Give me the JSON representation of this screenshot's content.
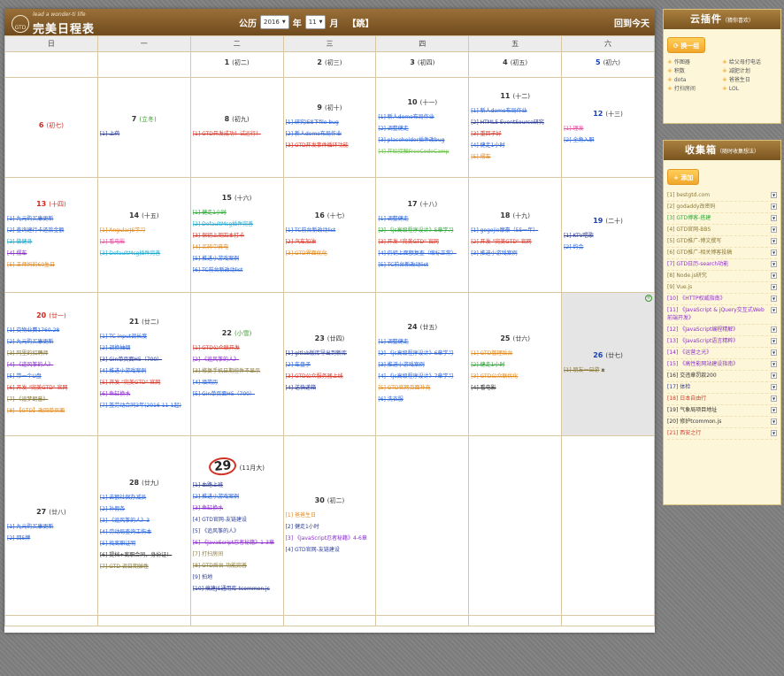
{
  "header": {
    "logo_slogan": "lead a wonder-ti life",
    "logo_badge": "GTD",
    "app_title": "完美日程表",
    "calendar_label": "公历",
    "year_value": "2016",
    "year_unit": "年",
    "month_value": "11",
    "month_unit": "月",
    "jump_label": "【跳】",
    "goto_today": "回到今天"
  },
  "weekdays": [
    "日",
    "一",
    "二",
    "三",
    "四",
    "五",
    "六"
  ],
  "weeks": [
    {
      "row": "r0",
      "cells": [
        {
          "empty": true
        },
        {
          "empty": true
        },
        {
          "day": "1",
          "lunar": "(初二)",
          "events": []
        },
        {
          "day": "2",
          "lunar": "(初三)",
          "events": []
        },
        {
          "day": "3",
          "lunar": "(初四)",
          "events": []
        },
        {
          "day": "4",
          "lunar": "(初五)",
          "events": []
        },
        {
          "day": "5",
          "lunar": "(初六)",
          "dow": "sat",
          "events": []
        }
      ]
    },
    {
      "row": "r1",
      "cells": [
        {
          "day": "6",
          "lunar": "(初七)",
          "dow": "sun",
          "events": []
        },
        {
          "day": "7",
          "lunar": "(立冬)",
          "term": true,
          "events": [
            {
              "text": "[1] 上药",
              "color": "c-navy",
              "done": true
            }
          ]
        },
        {
          "day": "8",
          "lunar": "(初九)",
          "events": [
            {
              "text": "[1] GTD开发成功！试运行！",
              "color": "c-red",
              "done": true
            }
          ]
        },
        {
          "day": "9",
          "lunar": "(初十)",
          "events": [
            {
              "text": "[1] 研究IE8下file bug",
              "color": "c-blue",
              "done": true
            },
            {
              "text": "[2] 新人demo布局作业",
              "color": "c-blue",
              "done": true
            },
            {
              "text": "[3] GTD开发事件循环功能",
              "color": "c-red",
              "done": true
            }
          ]
        },
        {
          "day": "10",
          "lunar": "(十一)",
          "events": [
            {
              "text": "[1] 新人demo布局作业",
              "color": "c-blue",
              "done": true
            },
            {
              "text": "[2] 调整健走",
              "color": "c-blue",
              "done": true
            },
            {
              "text": "[3] placeholder插件改bug",
              "color": "c-blue",
              "done": true
            },
            {
              "text": "[4] 开始接触FreeCodeCamp",
              "color": "c-lgreen",
              "done": true
            }
          ]
        },
        {
          "day": "11",
          "lunar": "(十二)",
          "events": [
            {
              "text": "[1] 新人demo布局作业",
              "color": "c-blue",
              "done": true
            },
            {
              "text": "[2] HTML5 EventSource研究",
              "color": "c-navy",
              "done": true
            },
            {
              "text": "[3] 重回子好",
              "color": "c-red",
              "done": true
            },
            {
              "text": "[4] 健走1小时",
              "color": "c-blue",
              "done": true
            },
            {
              "text": "[5] 摆车",
              "color": "c-orange",
              "done": true
            }
          ]
        },
        {
          "day": "12",
          "lunar": "(十三)",
          "dow": "sat",
          "events": [
            {
              "text": "[1] 理发",
              "color": "c-pink",
              "done": true
            },
            {
              "text": "[2] 全角入职",
              "color": "c-blue",
              "done": true
            }
          ]
        }
      ]
    },
    {
      "row": "r2",
      "cells": [
        {
          "day": "13",
          "lunar": "(十四)",
          "dow": "sun",
          "events": [
            {
              "text": "[1] 九元购买康更新",
              "color": "c-blue",
              "done": true
            },
            {
              "text": "[2] 查询建行卡还款金额",
              "color": "c-blue",
              "done": true
            },
            {
              "text": "[3] 做健身",
              "color": "c-cyan",
              "done": true
            },
            {
              "text": "[4] 摆车",
              "color": "c-purple",
              "done": true
            },
            {
              "text": "[5] 王师妈的60生日",
              "color": "c-orange",
              "done": true
            }
          ]
        },
        {
          "day": "14",
          "lunar": "(十五)",
          "events": [
            {
              "text": "[1] AngularJS学习",
              "color": "c-orange",
              "done": true
            },
            {
              "text": "[2] 看电影",
              "color": "c-pink",
              "done": true
            },
            {
              "text": "[3] DefaultMsg插件完善",
              "color": "c-cyan",
              "done": true
            }
          ]
        },
        {
          "day": "15",
          "lunar": "(十六)",
          "events": [
            {
              "text": "[1] 健走1小时",
              "color": "c-green",
              "done": true
            },
            {
              "text": "[2] DefaultMsg插件完善",
              "color": "c-cyan",
              "done": true
            },
            {
              "text": "[3] 保钥上周四本打卡",
              "color": "c-red",
              "done": true
            },
            {
              "text": "[4] 买碎中夹电",
              "color": "c-orange",
              "done": true
            },
            {
              "text": "[5] 推进小游戏案例",
              "color": "c-blue",
              "done": true
            },
            {
              "text": "[6] TC前台新改动list",
              "color": "c-blue",
              "done": true
            }
          ]
        },
        {
          "day": "16",
          "lunar": "(十七)",
          "events": [
            {
              "text": "[1] TC前台新改动list",
              "color": "c-blue",
              "done": true
            },
            {
              "text": "[2] 汽车加油",
              "color": "c-red",
              "done": true
            },
            {
              "text": "[3] GTD界面优化",
              "color": "c-orange",
              "done": true
            }
          ]
        },
        {
          "day": "17",
          "lunar": "(十八)",
          "events": [
            {
              "text": "[1] 调整健走",
              "color": "c-blue",
              "done": true
            },
            {
              "text": "[2] 《js高级程序设计》5章学习",
              "color": "c-green",
              "done": true
            },
            {
              "text": "[3] 开发 \"完美GTD\" 官网",
              "color": "c-red",
              "done": true
            },
            {
              "text": "[4] 仍钥上面额复查（缩标正常）",
              "color": "c-blue",
              "done": true
            },
            {
              "text": "[5] TC前台新改动list",
              "color": "c-blue",
              "done": true
            }
          ]
        },
        {
          "day": "18",
          "lunar": "(十九)",
          "events": [
            {
              "text": "[1] gogojie摩豪（55一年）",
              "color": "c-blue",
              "done": true
            },
            {
              "text": "[2] 开发 \"完美GTD\" 官网",
              "color": "c-red",
              "done": true
            },
            {
              "text": "[3] 推进小游戏案例",
              "color": "c-blue",
              "done": true
            }
          ]
        },
        {
          "day": "19",
          "lunar": "(二十)",
          "dow": "sat",
          "events": [
            {
              "text": "[1] KTV唱歌",
              "color": "c-navy",
              "done": true
            },
            {
              "text": "[2] 约会",
              "color": "c-blue",
              "done": true
            }
          ]
        }
      ]
    },
    {
      "row": "r3",
      "cells": [
        {
          "day": "20",
          "lunar": "(廿一)",
          "dow": "sun",
          "events": [
            {
              "text": "[1] 交物业费1760.28",
              "color": "c-blue",
              "done": true
            },
            {
              "text": "[2] 九元购买康更新",
              "color": "c-blue",
              "done": true
            },
            {
              "text": "[3] 阿里的招聘师",
              "color": "c-olive",
              "done": true
            },
            {
              "text": "[4] 《道风筝的人》",
              "color": "c-purple",
              "done": true
            },
            {
              "text": "[5] 带一个U盘",
              "color": "c-blue",
              "done": true
            },
            {
              "text": "[6] 开发 \"完美GTD\" 官网",
              "color": "c-red",
              "done": true
            },
            {
              "text": "[7] 《追梦朗普》",
              "color": "c-olive",
              "done": true
            },
            {
              "text": "[8] 【GTD】改回单页面",
              "color": "c-orange",
              "done": true
            }
          ]
        },
        {
          "day": "21",
          "lunar": "(廿二)",
          "events": [
            {
              "text": "[1] TC input调长度",
              "color": "c-blue",
              "done": true
            },
            {
              "text": "[2] 调换抽烟",
              "color": "c-blue",
              "done": true
            },
            {
              "text": "[3] Gin单页面H5（700）",
              "color": "c-navy",
              "done": true
            },
            {
              "text": "[4] 推进小游戏案例",
              "color": "c-blue",
              "done": true
            },
            {
              "text": "[5] 开发 \"完美GTD\" 官网",
              "color": "c-red",
              "done": true
            },
            {
              "text": "[6] 鱼缸换水",
              "color": "c-purple",
              "done": true
            },
            {
              "text": "[7] 签劳动合同3年(2016-11-1起)",
              "color": "c-blue",
              "done": true
            }
          ]
        },
        {
          "day": "22",
          "lunar": "(小雪)",
          "term": true,
          "events": [
            {
              "text": "[1] GTD公众联开发",
              "color": "c-red",
              "done": true
            },
            {
              "text": "[2] 《追风筝的人》",
              "color": "c-purple",
              "done": true
            },
            {
              "text": "[3] 修复手机日期控件不显示",
              "color": "c-olive",
              "done": true
            },
            {
              "text": "[4] 填简历",
              "color": "c-blue",
              "done": true
            },
            {
              "text": "[5] Gin单页面H5（700）",
              "color": "c-blue",
              "done": true
            }
          ]
        },
        {
          "day": "23",
          "lunar": "(廿四)",
          "events": [
            {
              "text": "[1] gitlab版库导出到新库",
              "color": "c-navy",
              "done": true
            },
            {
              "text": "[2] 车盘子",
              "color": "c-blue",
              "done": true
            },
            {
              "text": "[3] GTD公众服务器上线",
              "color": "c-red",
              "done": true
            },
            {
              "text": "[4] 送快递箱",
              "color": "c-navy",
              "done": true
            }
          ]
        },
        {
          "day": "24",
          "lunar": "(廿五)",
          "events": [
            {
              "text": "[1] 调整健走",
              "color": "c-blue",
              "done": true
            },
            {
              "text": "[2] 《js高级程序设计》6章学习",
              "color": "c-blue",
              "done": true
            },
            {
              "text": "[3] 推进小游戏案例",
              "color": "c-blue",
              "done": true
            },
            {
              "text": "[4] 《js高级程序设计》7章学习",
              "color": "c-blue",
              "done": true
            },
            {
              "text": "[5] GTD官网页面补充",
              "color": "c-orange",
              "done": true
            },
            {
              "text": "[6] 洗衣服",
              "color": "c-blue",
              "done": true
            }
          ]
        },
        {
          "day": "25",
          "lunar": "(廿六)",
          "events": [
            {
              "text": "[1] GTD管理后台",
              "color": "c-orange",
              "done": true
            },
            {
              "text": "[2] 健走1小时",
              "color": "c-green",
              "done": true
            },
            {
              "text": "[3] GTD公众联优化",
              "color": "c-orange",
              "done": true
            },
            {
              "text": "[4] 看电影",
              "color": "c-dark",
              "done": true
            }
          ]
        },
        {
          "day": "26",
          "lunar": "(廿七)",
          "dow": "sat",
          "gray": true,
          "plus": true,
          "events": [
            {
              "text": "[1] 朋友一日游",
              "color": "c-olive",
              "done": true,
              "dropdown": true
            }
          ]
        }
      ]
    },
    {
      "row": "r4",
      "cells": [
        {
          "day": "27",
          "lunar": "(廿八)",
          "events": [
            {
              "text": "[1] 九元购买康更新",
              "color": "c-blue",
              "done": true
            },
            {
              "text": "[2] 回5牌",
              "color": "c-blue",
              "done": true
            }
          ]
        },
        {
          "day": "28",
          "lunar": "(廿九)",
          "events": [
            {
              "text": "[1] 去额社保办减员",
              "color": "c-blue",
              "done": true
            },
            {
              "text": "[2] 补假条",
              "color": "c-blue",
              "done": true
            },
            {
              "text": "[3] 《追风筝的人》3",
              "color": "c-blue",
              "done": true
            },
            {
              "text": "[4] 劳动局查询工伤本",
              "color": "c-blue",
              "done": true
            },
            {
              "text": "[5] 找离职证明",
              "color": "c-blue",
              "done": true
            },
            {
              "text": "[6] 提档+离职合同，身份证！",
              "color": "c-dark",
              "done": true
            },
            {
              "text": "[7] GTD 调日期弹性",
              "color": "c-olive",
              "done": true
            }
          ]
        },
        {
          "day": "29",
          "lunar": "(11月大)",
          "today": true,
          "events": [
            {
              "text": "[1] 血路上班",
              "color": "c-navy",
              "done": true
            },
            {
              "text": "[2] 推进小游戏案例",
              "color": "c-blue",
              "done": true
            },
            {
              "text": "[3] 鱼缸换水",
              "color": "c-purple",
              "done": true
            },
            {
              "text": "[4] GTD官网-友链建设",
              "color": "c-navy",
              "done": false
            },
            {
              "text": "[5] 《追风筝的人》",
              "color": "c-navy",
              "done": false
            },
            {
              "text": "[6] 《JavaScript忍者秘籍》1-3章",
              "color": "c-purple",
              "done": true
            },
            {
              "text": "[7] 打扫房间",
              "color": "c-olive",
              "done": false
            },
            {
              "text": "[8] GTD后台-功能完善",
              "color": "c-olive",
              "done": true
            },
            {
              "text": "[9] 拍地",
              "color": "c-navy",
              "done": false
            },
            {
              "text": "[10] 搞建JS通用库-tcommon.js",
              "color": "c-navy",
              "done": true
            }
          ]
        },
        {
          "day": "30",
          "lunar": "(初二)",
          "events": [
            {
              "text": "[1] 爸爸生日",
              "color": "c-orange",
              "done": false
            },
            {
              "text": "[2] 健走1小时",
              "color": "c-navy",
              "done": false
            },
            {
              "text": "[3] 《JavaScript忍者秘籍》4-6章",
              "color": "c-purple",
              "done": false
            },
            {
              "text": "[4] GTD官网-友链建设",
              "color": "c-navy",
              "done": false
            }
          ]
        },
        {
          "empty": true
        },
        {
          "empty": true
        },
        {
          "empty": true
        }
      ]
    },
    {
      "row": "r5",
      "cells": [
        {
          "empty": true
        },
        {
          "empty": true
        },
        {
          "empty": true
        },
        {
          "empty": true
        },
        {
          "empty": true
        },
        {
          "empty": true
        },
        {
          "empty": true
        }
      ]
    }
  ],
  "cloud_panel": {
    "title": "云插件",
    "subtitle": "（猜你喜欢）",
    "switch_button": "换一组",
    "tools": [
      "作图器",
      "给父母打电话",
      "积数",
      "减肥计划",
      "dota",
      "爸爸生日",
      "打扫房间",
      "LOL"
    ]
  },
  "inbox_panel": {
    "title": "收集箱",
    "subtitle": "（随时收集想法）",
    "add_button": "添加",
    "items": [
      {
        "text": "[1] bestgtd.com",
        "color": "c-olive"
      },
      {
        "text": "[2] godaddy改密码",
        "color": "c-olive"
      },
      {
        "text": "[3] GTD博客-搭建",
        "color": "c-green"
      },
      {
        "text": "[4] GTD官网-BBS",
        "color": "c-olive"
      },
      {
        "text": "[5] GTD推广-博文撰写",
        "color": "c-olive"
      },
      {
        "text": "[6] GTD推广-相关博客投稿",
        "color": "c-olive"
      },
      {
        "text": "[7] GTD日历-search功能",
        "color": "c-purple"
      },
      {
        "text": "[8] Node.js研究",
        "color": "c-olive"
      },
      {
        "text": "[9] Vue.js",
        "color": "c-olive"
      },
      {
        "text": "[10] 《HTTP权威指南》",
        "color": "c-purple"
      },
      {
        "text": "[11] 《JavaScript & jQuery交互式Web前端开发》",
        "color": "c-purple"
      },
      {
        "text": "[12] 《JavaScript编程精解》",
        "color": "c-purple"
      },
      {
        "text": "[13] 《JavaScript语言精粹》",
        "color": "c-purple"
      },
      {
        "text": "[14] 《运营之光》",
        "color": "c-purple"
      },
      {
        "text": "[15] 《高性能网站建设指南》",
        "color": "c-purple"
      },
      {
        "text": "[16] 交违章罚款200",
        "color": "c-dark"
      },
      {
        "text": "[17] 体检",
        "color": "c-navy"
      },
      {
        "text": "[18] 日本自由行",
        "color": "c-red"
      },
      {
        "text": "[19] 气象局项目地址",
        "color": "c-dark"
      },
      {
        "text": "[20] 修护tcommon.js",
        "color": "c-dark"
      },
      {
        "text": "[21] 西安之行",
        "color": "c-red"
      }
    ]
  }
}
